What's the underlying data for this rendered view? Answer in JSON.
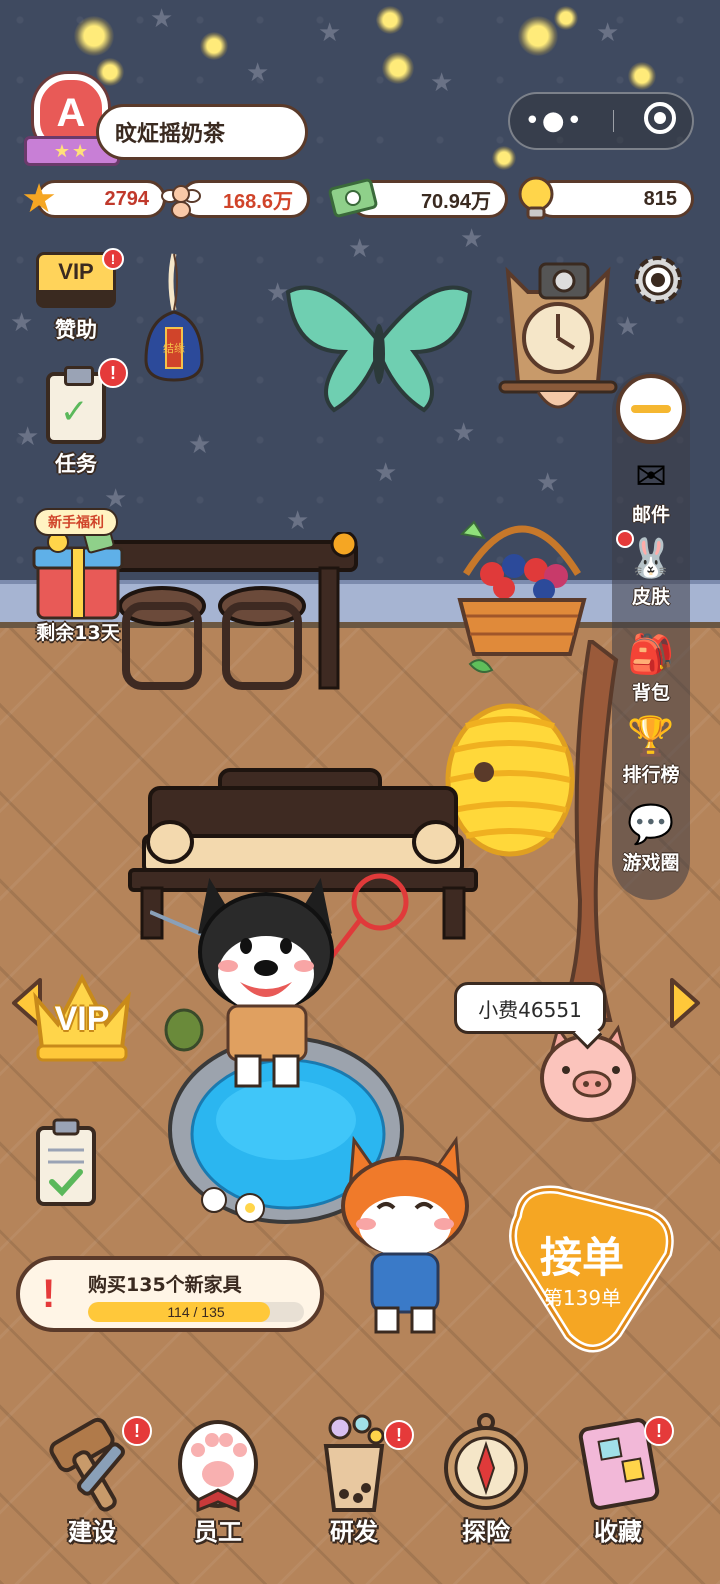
{
  "player": {
    "rank_letter": "A",
    "rank_stars": "★★",
    "name": "旼炡摇奶茶"
  },
  "resources": {
    "stars": "2794",
    "fans": "168.6万",
    "money": "70.94万",
    "ideas": "815"
  },
  "capsule": {
    "more_icon": "dots-icon",
    "close_icon": "target-icon"
  },
  "left_menu": {
    "vip_card_text": "VIP",
    "sponsor_label": "赞助",
    "task_label": "任务",
    "gift_tag": "新手福利",
    "gift_remaining": "剩余13天",
    "badge_mark": "!"
  },
  "right_menu": {
    "mail_label": "邮件",
    "skin_label": "皮肤",
    "bag_label": "背包",
    "rank_label": "排行榜",
    "circle_label": "游戏圈"
  },
  "scene": {
    "vip_label": "VIP",
    "tip_text": "小费46551",
    "charm_text": "结缘"
  },
  "quest": {
    "title": "购买135个新家具",
    "current": 114,
    "total": 135,
    "progress_text": "114 / 135"
  },
  "accept": {
    "title": "接单",
    "subtitle": "第139单"
  },
  "bottom_nav": [
    {
      "label": "建设",
      "icon": "hammer-icon",
      "badge": true
    },
    {
      "label": "员工",
      "icon": "paw-icon",
      "badge": false
    },
    {
      "label": "研发",
      "icon": "bubble-tea-icon",
      "badge": true
    },
    {
      "label": "探险",
      "icon": "compass-icon",
      "badge": false
    },
    {
      "label": "收藏",
      "icon": "album-icon",
      "badge": true
    }
  ],
  "colors": {
    "wall": "#3f4a60",
    "floor": "#b5845a",
    "accent_orange": "#f5a623",
    "badge_red": "#e53a3a"
  }
}
